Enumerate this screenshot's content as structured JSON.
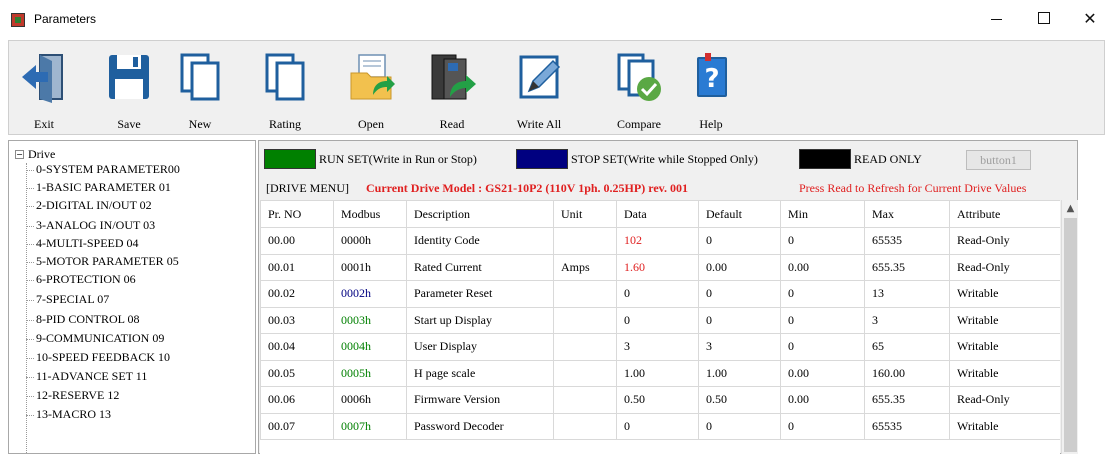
{
  "window": {
    "title": "Parameters"
  },
  "toolbar": {
    "buttons": [
      {
        "label": "Exit",
        "icon": "exit-door-icon"
      },
      {
        "label": "Save",
        "icon": "floppy-disk-icon"
      },
      {
        "label": "New",
        "icon": "new-document-icon"
      },
      {
        "label": "Rating",
        "icon": "rating-document-icon"
      },
      {
        "label": "Open",
        "icon": "open-folder-icon"
      },
      {
        "label": "Read",
        "icon": "read-drive-icon"
      },
      {
        "label": "Write All",
        "icon": "write-all-icon"
      },
      {
        "label": "Compare",
        "icon": "compare-check-icon"
      },
      {
        "label": "Help",
        "icon": "help-book-icon"
      }
    ]
  },
  "tree": {
    "root": "Drive",
    "items": [
      "0-SYSTEM PARAMETER00",
      "1-BASIC PARAMETER 01",
      "2-DIGITAL IN/OUT  02",
      "3-ANALOG IN/OUT  03",
      "4-MULTI-SPEED   04",
      "5-MOTOR PARAMETER 05",
      "6-PROTECTION   06",
      "7-SPECIAL      07",
      "8-PID CONTROL   08",
      "9-COMMUNICATION  09",
      "10-SPEED FEEDBACK  10",
      "11-ADVANCE SET   11",
      "12-RESERVE      12",
      "13-MACRO        13"
    ]
  },
  "legend": {
    "run_set": "RUN SET(Write in Run or Stop)",
    "stop_set": "STOP SET(Write while Stopped Only)",
    "read_only": "READ ONLY",
    "button1": "button1",
    "colors": {
      "run": "#008000",
      "stop": "#000080",
      "read_only": "#000000"
    }
  },
  "info": {
    "menu": "[DRIVE MENU]",
    "model": "Current Drive Model : GS21-10P2 (110V 1ph. 0.25HP) rev. 001",
    "hint": "Press Read to Refresh for Current Drive Values"
  },
  "table": {
    "headers": [
      "Pr. NO",
      "Modbus",
      "Description",
      "Unit",
      "Data",
      "Default",
      "Min",
      "Max",
      "Attribute"
    ],
    "rows": [
      {
        "prno": "00.00",
        "modbus": "0000h",
        "desc": "Identity Code",
        "unit": "",
        "data": "102",
        "def": "0",
        "min": "0",
        "max": "65535",
        "attr": "Read-Only",
        "modbus_color": "#000000",
        "data_color": "#e02020"
      },
      {
        "prno": "00.01",
        "modbus": "0001h",
        "desc": "Rated Current",
        "unit": "Amps",
        "data": "1.60",
        "def": "0.00",
        "min": "0.00",
        "max": "655.35",
        "attr": "Read-Only",
        "modbus_color": "#000000",
        "data_color": "#e02020"
      },
      {
        "prno": "00.02",
        "modbus": "0002h",
        "desc": "Parameter Reset",
        "unit": "",
        "data": "0",
        "def": "0",
        "min": "0",
        "max": "13",
        "attr": "Writable",
        "modbus_color": "#000080",
        "data_color": "#000000"
      },
      {
        "prno": "00.03",
        "modbus": "0003h",
        "desc": "Start up Display",
        "unit": "",
        "data": "0",
        "def": "0",
        "min": "0",
        "max": "3",
        "attr": "Writable",
        "modbus_color": "#008000",
        "data_color": "#000000"
      },
      {
        "prno": "00.04",
        "modbus": "0004h",
        "desc": "User Display",
        "unit": "",
        "data": "3",
        "def": "3",
        "min": "0",
        "max": "65",
        "attr": "Writable",
        "modbus_color": "#008000",
        "data_color": "#000000"
      },
      {
        "prno": "00.05",
        "modbus": "0005h",
        "desc": "H page scale",
        "unit": "",
        "data": "1.00",
        "def": "1.00",
        "min": "0.00",
        "max": "160.00",
        "attr": "Writable",
        "modbus_color": "#008000",
        "data_color": "#000000"
      },
      {
        "prno": "00.06",
        "modbus": "0006h",
        "desc": "Firmware Version",
        "unit": "",
        "data": "0.50",
        "def": "0.50",
        "min": "0.00",
        "max": "655.35",
        "attr": "Read-Only",
        "modbus_color": "#000000",
        "data_color": "#000000"
      },
      {
        "prno": "00.07",
        "modbus": "0007h",
        "desc": "Password Decoder",
        "unit": "",
        "data": "0",
        "def": "0",
        "min": "0",
        "max": "65535",
        "attr": "Writable",
        "modbus_color": "#008000",
        "data_color": "#000000"
      }
    ]
  }
}
